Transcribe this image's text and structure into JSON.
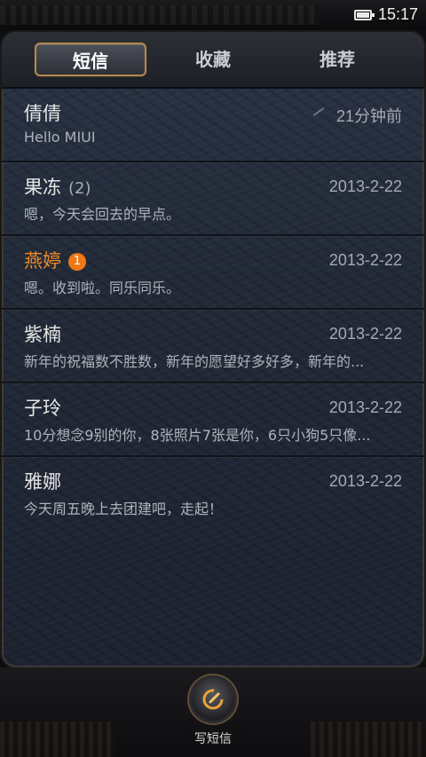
{
  "status_bar": {
    "time": "15:17",
    "battery_level": 1.0
  },
  "tabs": [
    {
      "label": "短信",
      "active": true
    },
    {
      "label": "收藏",
      "active": false
    },
    {
      "label": "推荐",
      "active": false
    }
  ],
  "conversations": [
    {
      "name": "倩倩",
      "count": "",
      "unread": "",
      "date": "21分钟前",
      "preview": "Hello MIUI",
      "sent": true
    },
    {
      "name": "果冻",
      "count": "(2)",
      "unread": "",
      "date": "2013-2-22",
      "preview": "嗯，今天会回去的早点。"
    },
    {
      "name": "燕婷",
      "count": "",
      "unread": "1",
      "date": "2013-2-22",
      "preview": "嗯。收到啦。同乐同乐。"
    },
    {
      "name": "紫楠",
      "count": "",
      "unread": "",
      "date": "2013-2-22",
      "preview": "新年的祝福数不胜数，新年的愿望好多好多，新年的..."
    },
    {
      "name": "子玲",
      "count": "",
      "unread": "",
      "date": "2013-2-22",
      "preview": "10分想念9别的你，8张照片7张是你，6只小狗5只像..."
    },
    {
      "name": "雅娜",
      "count": "",
      "unread": "",
      "date": "2013-2-22",
      "preview": "今天周五晚上去团建吧，走起！"
    }
  ],
  "bottom_bar": {
    "compose_label": "写短信",
    "compose_icon": "compose-icon"
  },
  "colors": {
    "accent_unread": "#f08a28",
    "badge": "#f07818",
    "tab_border": "#b08a55"
  }
}
